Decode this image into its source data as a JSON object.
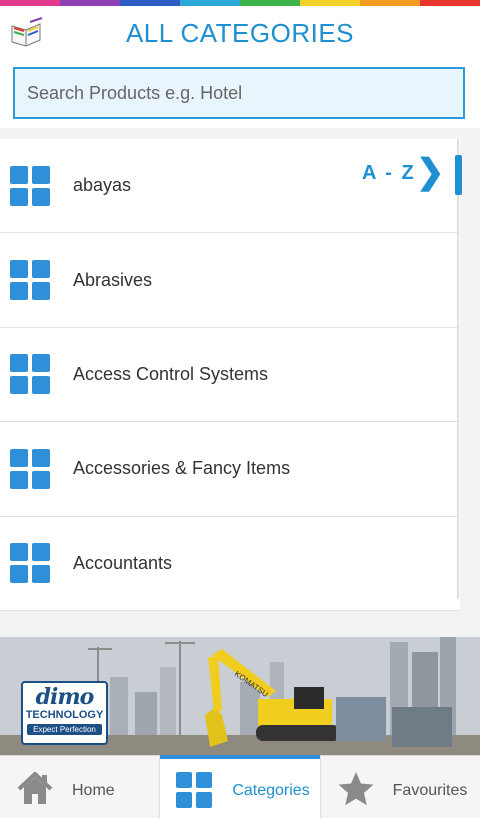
{
  "header": {
    "title": "ALL CATEGORIES",
    "rainbow_colors": [
      "#e23a8c",
      "#8d3fb4",
      "#2d5cc4",
      "#2aa8d8",
      "#3db349",
      "#f2d12b",
      "#f39b1f",
      "#e8352e"
    ]
  },
  "search": {
    "placeholder": "Search Products e.g. Hotel",
    "value": ""
  },
  "index": {
    "label": "A - Z",
    "arrow": "❯"
  },
  "categories": [
    {
      "label": "abayas"
    },
    {
      "label": "Abrasives"
    },
    {
      "label": "Access Control Systems"
    },
    {
      "label": "Accessories & Fancy Items"
    },
    {
      "label": "Accountants"
    }
  ],
  "banner": {
    "brand_name": "dimo",
    "brand_sub": "TECHNOLOGY",
    "brand_tagline": "Expect Perfection",
    "excavator_text": "KOMATSU"
  },
  "tabs": [
    {
      "label": "Home",
      "icon": "home-icon",
      "active": false
    },
    {
      "label": "Categories",
      "icon": "grid-icon",
      "active": true
    },
    {
      "label": "Favourites",
      "icon": "star-icon",
      "active": false
    }
  ],
  "colors": {
    "accent": "#1e8fd0",
    "icon_blue": "#2f8fd8"
  }
}
